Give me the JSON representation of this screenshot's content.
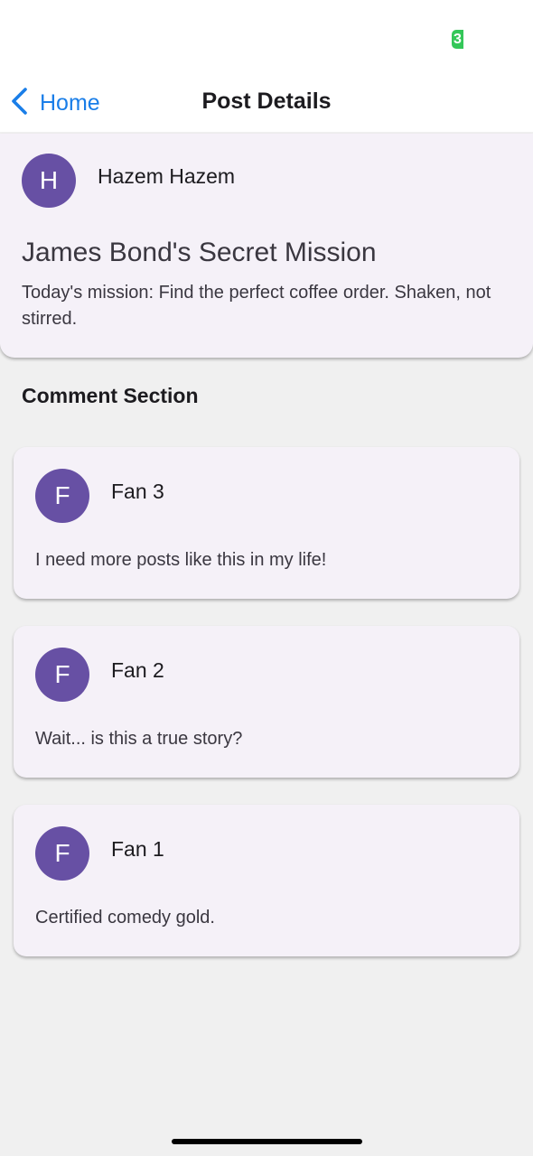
{
  "status_bar": {
    "badge": "3",
    "badge_color": "#34c759"
  },
  "nav": {
    "back_label": "Home",
    "title": "Post Details",
    "accent": "#1a7ee8"
  },
  "post": {
    "avatar_letter": "H",
    "author": "Hazem Hazem",
    "title": "James Bond's Secret Mission",
    "body": "Today's mission: Find the perfect coffee order. Shaken, not stirred."
  },
  "comments_heading": "Comment Section",
  "comments": [
    {
      "avatar_letter": "F",
      "author": "Fan 3",
      "text": "I need more posts like this in my life!"
    },
    {
      "avatar_letter": "F",
      "author": "Fan 2",
      "text": "Wait... is this a true story?"
    },
    {
      "avatar_letter": "F",
      "author": "Fan 1",
      "text": "Certified comedy gold."
    }
  ],
  "colors": {
    "avatar": "#6750a4",
    "card": "#f5f1f8",
    "background": "#f0f0f0"
  }
}
